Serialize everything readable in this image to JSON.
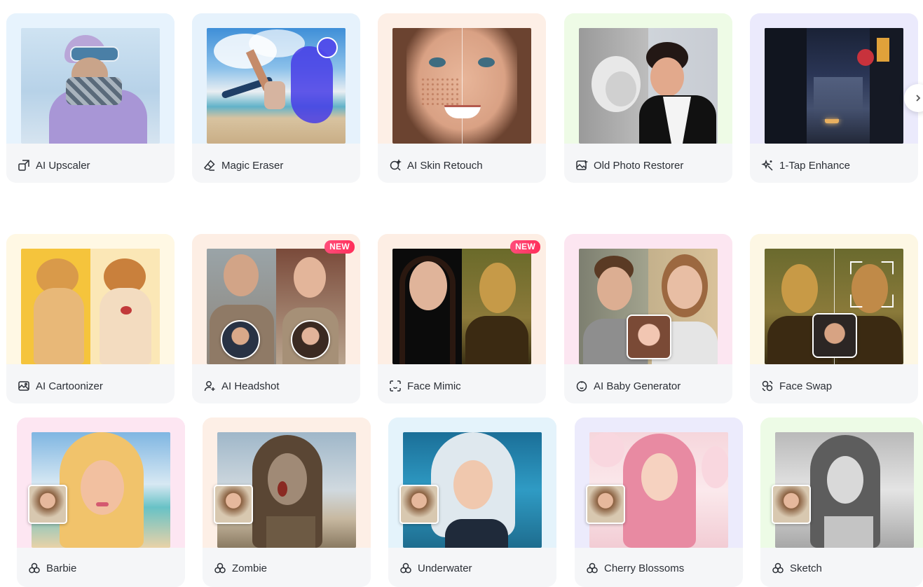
{
  "row1": [
    {
      "label": "AI Upscaler",
      "icon": "upscale-icon",
      "bg": "#e7f3fd"
    },
    {
      "label": "Magic Eraser",
      "icon": "eraser-icon",
      "bg": "#e6f2fc"
    },
    {
      "label": "AI Skin Retouch",
      "icon": "skin-retouch-icon",
      "bg": "#fdefe6"
    },
    {
      "label": "Old Photo Restorer",
      "icon": "photo-restore-icon",
      "bg": "#eefbe6"
    },
    {
      "label": "1-Tap Enhance",
      "icon": "enhance-icon",
      "bg": "#ebeafc"
    }
  ],
  "row2": [
    {
      "label": "AI Cartoonizer",
      "icon": "cartoon-icon",
      "bg": "#fff8e4",
      "badge": ""
    },
    {
      "label": "AI Headshot",
      "icon": "headshot-icon",
      "bg": "#fdeee4",
      "badge": "NEW"
    },
    {
      "label": "Face Mimic",
      "icon": "face-mimic-icon",
      "bg": "#fdeee4",
      "badge": "NEW"
    },
    {
      "label": "AI Baby Generator",
      "icon": "baby-icon",
      "bg": "#fce6f1",
      "badge": ""
    },
    {
      "label": "Face Swap",
      "icon": "face-swap-icon",
      "bg": "#fdf7e4",
      "badge": ""
    }
  ],
  "row3": [
    {
      "label": "Barbie",
      "icon": "style-icon",
      "bg": "#fde6f2"
    },
    {
      "label": "Zombie",
      "icon": "style-icon",
      "bg": "#fdefe6"
    },
    {
      "label": "Underwater",
      "icon": "style-icon",
      "bg": "#e4f3fb"
    },
    {
      "label": "Cherry Blossoms",
      "icon": "style-icon",
      "bg": "#ecebfc"
    },
    {
      "label": "Sketch",
      "icon": "style-icon",
      "bg": "#edfbe6"
    }
  ],
  "colors": {
    "badge": "#ff3a66",
    "card": "#f5f6f8",
    "text": "#2b2f36"
  }
}
